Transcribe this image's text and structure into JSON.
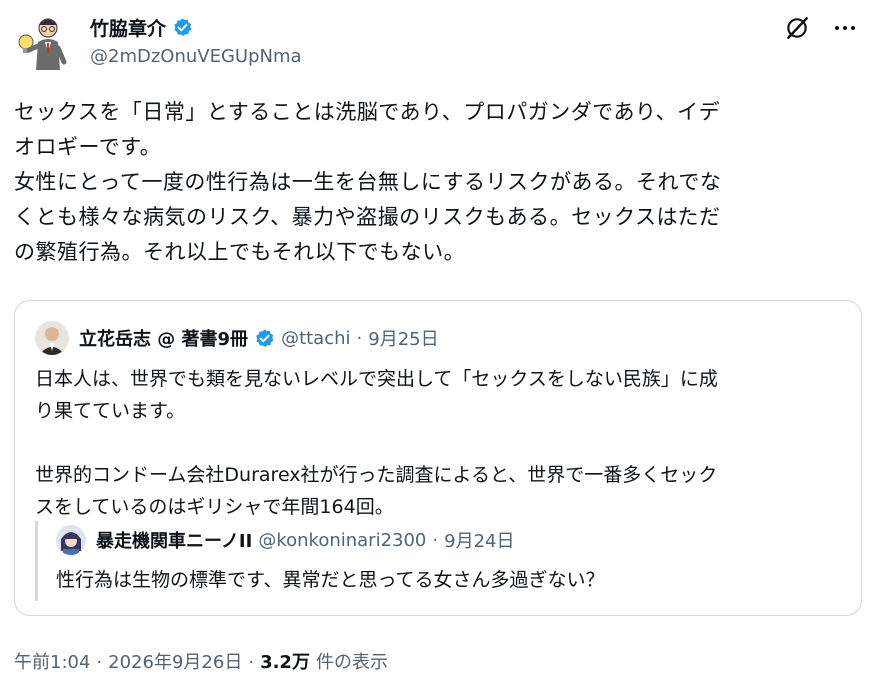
{
  "author": {
    "name": "竹脇章介",
    "handle": "@2mDzOnuVEGUpNma",
    "verified": true
  },
  "header_icons": [
    "grok-icon",
    "more-icon"
  ],
  "tweet": {
    "text": "セックスを「日常」とすることは洗脳であり、プロパガンダであり、イデ\nオロギーです。\n女性にとって一度の性行為は一生を台無しにするリスクがある。それでな\nくとも様々な病気のリスク、暴力や盗撮のリスクもある。セックスはただ\nの繁殖行為。それ以上でもそれ以下でもない。"
  },
  "quote": {
    "name": "立花岳志 @ 著書9冊",
    "handle": "@ttachi",
    "date": "9月25日",
    "text": "日本人は、世界でも類を見ないレベルで突出して「セックスをしない民族」に成\nり果てています。\n\n世界的コンドーム会社Durarex社が行った調査によると、世界で一番多くセック\nスをしているのはギリシャで年間164回。"
  },
  "nested_quote": {
    "name": "暴走機関車ニーノII",
    "handle": "@konkoninari2300",
    "date": "9月24日",
    "text": "性行為は生物の標準です、異常だと思ってる女さん多過ぎない？"
  },
  "footer": {
    "time": "午前1:04",
    "date": "2026年9月26日",
    "views": "3.2万",
    "views_label": "件の表示",
    "separator": "·"
  },
  "colors": {
    "text": "#0f1419",
    "secondary": "#536471",
    "border": "#cfd9de",
    "verified": "#1d9bf0"
  }
}
